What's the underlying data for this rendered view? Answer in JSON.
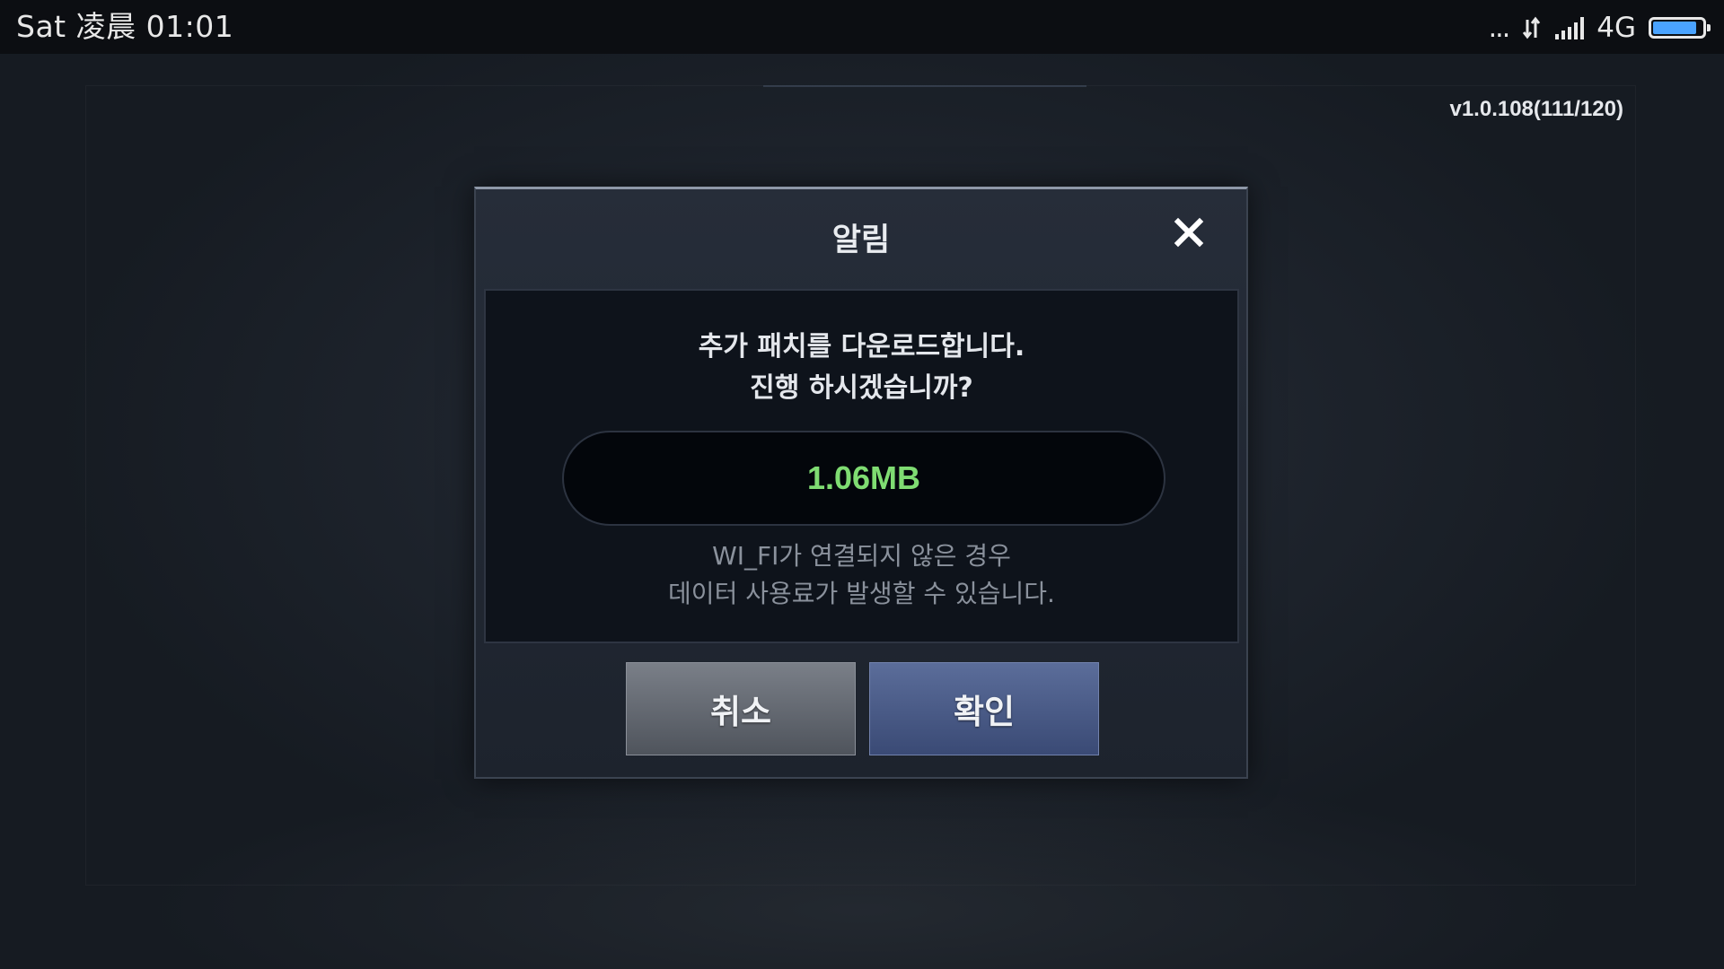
{
  "status_bar": {
    "day": "Sat",
    "period": "凌晨",
    "time": "01:01",
    "more_indicator": "...",
    "network_type": "4G",
    "battery_level_percent": 90,
    "icons": [
      "more-dots-icon",
      "data-transfer-icon",
      "signal-strength-icon",
      "battery-icon"
    ]
  },
  "game": {
    "version": "v1.0.108(111/120)"
  },
  "dialog": {
    "title": "알림",
    "close_icon": "close-icon",
    "message_line1": "추가 패치를 다운로드합니다.",
    "message_line2": "진행 하시겠습니까?",
    "download_size": "1.06MB",
    "warning_line1": "WI_FI가 연결되지 않은 경우",
    "warning_line2": "데이터 사용료가 발생할 수 있습니다.",
    "cancel_label": "취소",
    "confirm_label": "확인"
  },
  "colors": {
    "size_text": "#7fdc72",
    "confirm_button": "#4a5b88",
    "cancel_button": "#646971"
  }
}
